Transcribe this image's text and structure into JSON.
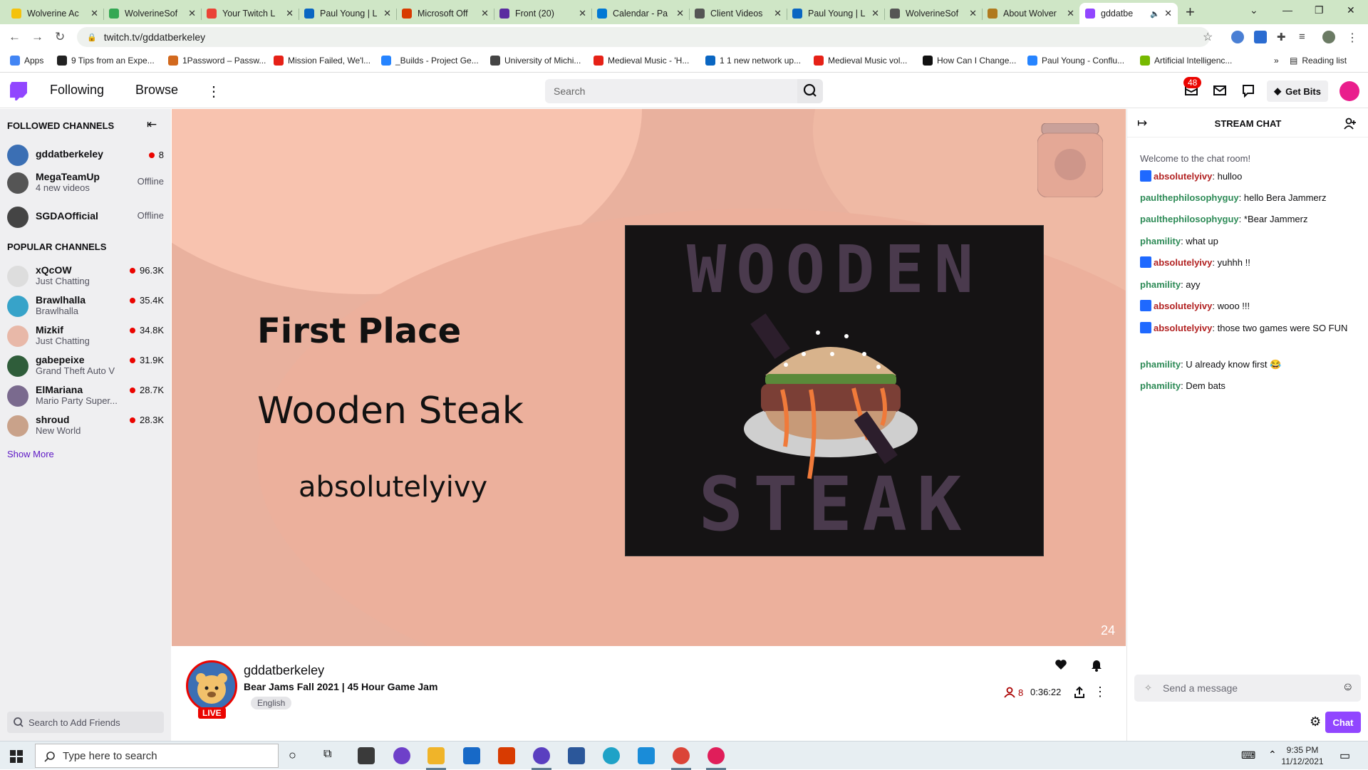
{
  "browser": {
    "tabs": [
      {
        "label": "Wolverine Ac",
        "color": "#f4c20d"
      },
      {
        "label": "WolverineSof",
        "color": "#34a853"
      },
      {
        "label": "Your Twitch L",
        "color": "#ea4335"
      },
      {
        "label": "Paul Young | L",
        "color": "#0a66c2"
      },
      {
        "label": "Microsoft Off",
        "color": "#d83b01"
      },
      {
        "label": "Front (20)",
        "color": "#5a2ca0"
      },
      {
        "label": "Calendar - Pa",
        "color": "#0078d4"
      },
      {
        "label": "Client Videos",
        "color": "#555555"
      },
      {
        "label": "Paul Young | L",
        "color": "#0a66c2"
      },
      {
        "label": "WolverineSof",
        "color": "#555555"
      },
      {
        "label": "About Wolver",
        "color": "#b07a1e"
      },
      {
        "label": "gddatbe",
        "color": "#9146ff"
      }
    ],
    "url": "twitch.tv/gddatberkeley",
    "bookmarks": [
      {
        "label": "Apps",
        "color": "#4285f4"
      },
      {
        "label": "9 Tips from an Expe...",
        "color": "#222222"
      },
      {
        "label": "1Password – Passw...",
        "color": "#d2691e"
      },
      {
        "label": "Mission Failed, We'l...",
        "color": "#e62117"
      },
      {
        "label": "_Builds - Project Ge...",
        "color": "#2684ff"
      },
      {
        "label": "University of Michi...",
        "color": "#444444"
      },
      {
        "label": "Medieval Music - 'H...",
        "color": "#e62117"
      },
      {
        "label": "1 1 new network up...",
        "color": "#0a66c2"
      },
      {
        "label": "Medieval Music vol...",
        "color": "#e62117"
      },
      {
        "label": "How Can I Change...",
        "color": "#111111"
      },
      {
        "label": "Paul Young - Conflu...",
        "color": "#2684ff"
      },
      {
        "label": "Artificial Intelligenc...",
        "color": "#76b900"
      }
    ],
    "reading_list": "Reading list"
  },
  "twitch": {
    "nav": {
      "following": "Following",
      "browse": "Browse"
    },
    "search_placeholder": "Search",
    "notif_count": "48",
    "get_bits": "Get Bits",
    "followed_header": "FOLLOWED CHANNELS",
    "popular_header": "POPULAR CHANNELS",
    "followed": [
      {
        "name": "gddatberkeley",
        "status": "8",
        "sub": "",
        "live": true,
        "color": "#3b6fb4"
      },
      {
        "name": "MegaTeamUp",
        "status": "Offline",
        "sub": "4 new videos",
        "live": false,
        "color": "#555555"
      },
      {
        "name": "SGDAOfficial",
        "status": "Offline",
        "sub": "",
        "live": false,
        "color": "#444444"
      }
    ],
    "popular": [
      {
        "name": "xQcOW",
        "sub": "Just Chatting",
        "viewers": "96.3K",
        "color": "#dddddd"
      },
      {
        "name": "Brawlhalla",
        "sub": "Brawlhalla",
        "viewers": "35.4K",
        "color": "#37a3c9"
      },
      {
        "name": "Mizkif",
        "sub": "Just Chatting",
        "viewers": "34.8K",
        "color": "#e8b8a8"
      },
      {
        "name": "gabepeixe",
        "sub": "Grand Theft Auto V",
        "viewers": "31.9K",
        "color": "#2f5d3a"
      },
      {
        "name": "ElMariana",
        "sub": "Mario Party Super...",
        "viewers": "28.7K",
        "color": "#7a6a8e"
      },
      {
        "name": "shroud",
        "sub": "New World",
        "viewers": "28.3K",
        "color": "#c9a28a"
      }
    ],
    "show_more": "Show More",
    "add_friends_placeholder": "Search to Add Friends"
  },
  "player": {
    "line1": "First Place",
    "line2": "Wooden Steak",
    "line3": "absolutelyivy",
    "art_top": "WOODEN",
    "art_bottom": "STEAK",
    "frame_number": "24"
  },
  "stream": {
    "channel": "gddatberkeley",
    "live_label": "LIVE",
    "title": "Bear Jams Fall 2021 | 45 Hour Game Jam",
    "language": "English",
    "viewers": "8",
    "uptime": "0:36:22"
  },
  "chat": {
    "title": "STREAM CHAT",
    "welcome": "Welcome to the chat room!",
    "messages": [
      {
        "user": "absolutelyivy",
        "text": ": hulloo",
        "color": "#b22222",
        "mod": true
      },
      {
        "user": "paulthephilosophyguy",
        "text": ": hello Bera Jammerz",
        "color": "#2e8b57",
        "mod": false
      },
      {
        "user": "paulthephilosophyguy",
        "text": ": *Bear Jammerz",
        "color": "#2e8b57",
        "mod": false
      },
      {
        "user": "phamility",
        "text": ": what up",
        "color": "#2e8b57",
        "mod": false
      },
      {
        "user": "absolutelyivy",
        "text": ": yuhhh !!",
        "color": "#b22222",
        "mod": true
      },
      {
        "user": "phamility",
        "text": ": ayy",
        "color": "#2e8b57",
        "mod": false
      },
      {
        "user": "absolutelyivy",
        "text": ": wooo !!!",
        "color": "#b22222",
        "mod": true
      },
      {
        "user": "absolutelyivy",
        "text": ": those two games were SO FUN",
        "color": "#b22222",
        "mod": true
      },
      {
        "user": "phamility",
        "text": ": U already know first",
        "color": "#2e8b57",
        "mod": false
      },
      {
        "user": "phamility",
        "text": ": Dem bats",
        "color": "#2e8b57",
        "mod": false
      }
    ],
    "input_placeholder": "Send a message",
    "send_label": "Chat"
  },
  "taskbar": {
    "search_placeholder": "Type here to search",
    "time": "9:35 PM",
    "date": "11/12/2021"
  }
}
